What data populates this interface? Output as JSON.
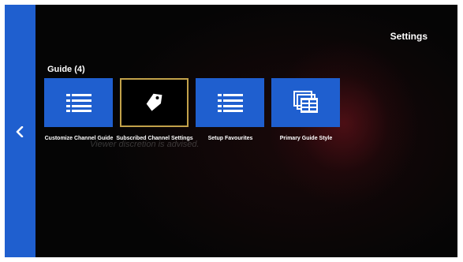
{
  "screen": {
    "title": "Settings",
    "section_title": "Guide (4)",
    "background_text": "Viewer discretion is advised."
  },
  "tiles": [
    {
      "label": "Customize Channel Guide",
      "icon": "list-icon",
      "selected": false
    },
    {
      "label": "Subscribed Channel Settings",
      "icon": "tag-icon",
      "selected": true
    },
    {
      "label": "Setup Favourites",
      "icon": "list-icon",
      "selected": false
    },
    {
      "label": "Primary Guide Style",
      "icon": "guide-grid-icon",
      "selected": false
    }
  ],
  "colors": {
    "accent": "#1f5fcf",
    "selected_border": "#c2a24a",
    "background": "#050505"
  },
  "icons": {
    "back": "chevron-left-icon"
  }
}
